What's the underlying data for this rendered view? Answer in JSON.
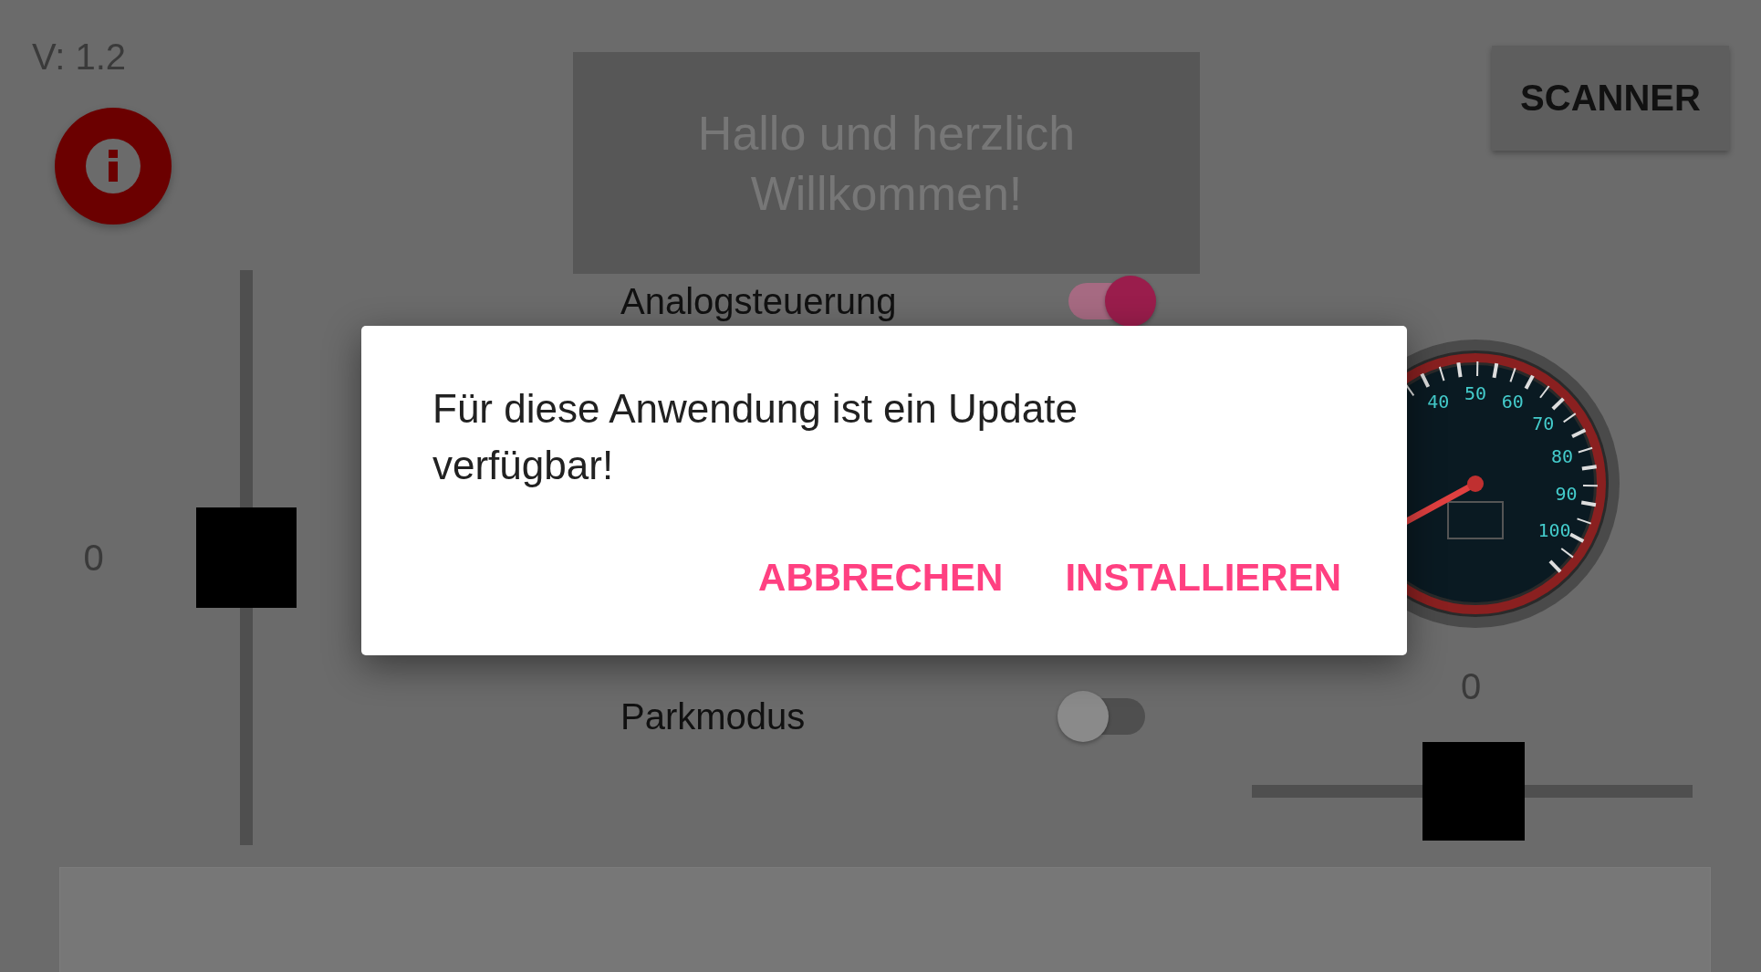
{
  "version": "V: 1.2",
  "welcome": "Hallo und herzlich Willkommen!",
  "scanner_button": "SCANNER",
  "vertical_slider": {
    "reading": "0",
    "level": 0.5
  },
  "switches": [
    {
      "label": "Analogsteuerung",
      "on": true
    },
    {
      "label": "Parkmodus",
      "on": false
    }
  ],
  "gauge_labels": [
    "40",
    "50",
    "60",
    "70",
    "80",
    "90",
    "100"
  ],
  "horizontal_slider": {
    "reading": "0",
    "level": 0.5
  },
  "dialog": {
    "message": "Für diese Anwendung ist ein Update verfügbar!",
    "buttons": [
      "ABBRECHEN",
      "INSTALLIEREN"
    ]
  }
}
